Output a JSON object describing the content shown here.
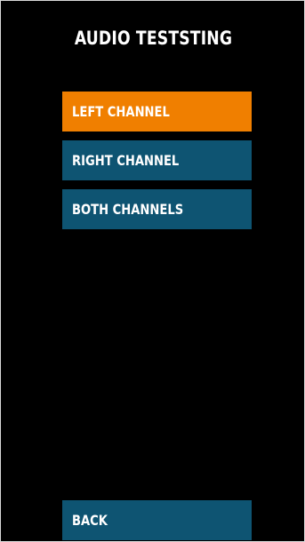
{
  "screen": {
    "title": "AUDIO TESTSTING"
  },
  "menu": {
    "items": [
      {
        "label": "LEFT CHANNEL",
        "state": "selected",
        "color": "#f07f00"
      },
      {
        "label": "RIGHT CHANNEL",
        "state": "default",
        "color": "#0e5472"
      },
      {
        "label": "BOTH CHANNELS",
        "state": "default",
        "color": "#0e5472"
      }
    ]
  },
  "footer": {
    "back_label": "BACK",
    "back_color": "#0e5472"
  },
  "colors": {
    "background": "#000000",
    "text": "#ffffff",
    "accent": "#f07f00",
    "button": "#0e5472"
  }
}
